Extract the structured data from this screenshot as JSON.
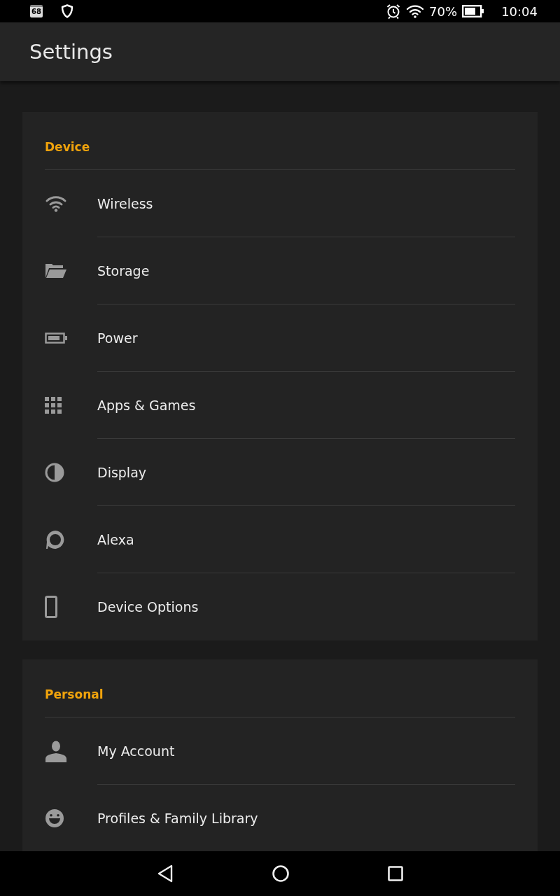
{
  "status_bar": {
    "calendar_badge": "68",
    "battery": "70%",
    "time": "10:04"
  },
  "app_bar": {
    "title": "Settings"
  },
  "sections": [
    {
      "title": "Device",
      "items": [
        {
          "kind": "wifi",
          "label": "Wireless"
        },
        {
          "kind": "folder",
          "label": "Storage"
        },
        {
          "kind": "battery",
          "label": "Power"
        },
        {
          "kind": "grid",
          "label": "Apps & Games"
        },
        {
          "kind": "contrast",
          "label": "Display"
        },
        {
          "kind": "ring",
          "label": "Alexa"
        },
        {
          "kind": "phone",
          "label": "Device Options"
        }
      ]
    },
    {
      "title": "Personal",
      "items": [
        {
          "kind": "person",
          "label": "My Account"
        },
        {
          "kind": "smile",
          "label": "Profiles & Family Library"
        }
      ]
    }
  ]
}
